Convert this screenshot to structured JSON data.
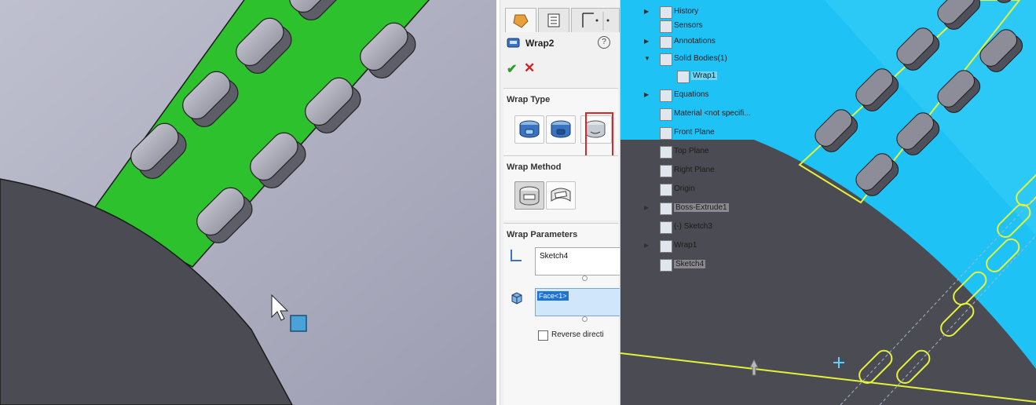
{
  "property_manager": {
    "feature_name": "Wrap2",
    "help_glyph": "?",
    "ok_glyph": "✔",
    "cancel_glyph": "✕",
    "wrap_type": {
      "title": "Wrap Type",
      "options": [
        "emboss-type-icon",
        "deboss-type-icon",
        "scribe-type-icon"
      ],
      "highlighted_option": "scribe"
    },
    "wrap_method": {
      "title": "Wrap Method",
      "options": [
        "analytical-method-icon",
        "spline-surface-method-icon"
      ],
      "selected": "analytical"
    },
    "wrap_parameters": {
      "title": "Wrap Parameters",
      "sketch_value": "Sketch4",
      "face_value": "Face<1>",
      "reverse_direction_label": "Reverse directi",
      "reverse_direction_checked": false
    }
  },
  "feature_tree": {
    "items": [
      {
        "label": "History",
        "expandable": true,
        "icon": "history-icon"
      },
      {
        "label": "Sensors",
        "expandable": false,
        "icon": "sensors-icon"
      },
      {
        "label": "Annotations",
        "expandable": true,
        "icon": "annotations-icon"
      },
      {
        "label": "Solid Bodies(1)",
        "expandable": true,
        "expanded": true,
        "icon": "solid-bodies-icon"
      },
      {
        "label": "Wrap1",
        "expandable": false,
        "icon": "solid-body-icon",
        "child": true,
        "highlighted": true
      },
      {
        "label": "Equations",
        "expandable": true,
        "icon": "equations-icon"
      },
      {
        "label": "Material <not specifi...",
        "expandable": false,
        "icon": "material-icon"
      },
      {
        "label": "Front Plane",
        "expandable": false,
        "icon": "plane-icon"
      },
      {
        "label": "Top Plane",
        "expandable": false,
        "icon": "plane-icon"
      },
      {
        "label": "Right Plane",
        "expandable": false,
        "icon": "plane-icon"
      },
      {
        "label": "Origin",
        "expandable": false,
        "icon": "origin-icon"
      },
      {
        "label": "Boss-Extrude1",
        "expandable": true,
        "icon": "boss-extrude-icon",
        "highlighted": true
      },
      {
        "label": "(-) Sketch3",
        "expandable": false,
        "icon": "sketch-icon",
        "child": true
      },
      {
        "label": "Wrap1",
        "expandable": true,
        "icon": "wrap-feature-icon"
      },
      {
        "label": "Sketch4",
        "expandable": false,
        "icon": "sketch-icon",
        "highlighted": true
      }
    ]
  },
  "colors": {
    "cylinder_face": "#a8a9bc",
    "dark_body": "#4b4b53",
    "selected_face": "#2ec12e",
    "blue_body": "#1fc2f5",
    "sketch_yellow": "#e6f23a",
    "highlight_box": "#e02424"
  }
}
